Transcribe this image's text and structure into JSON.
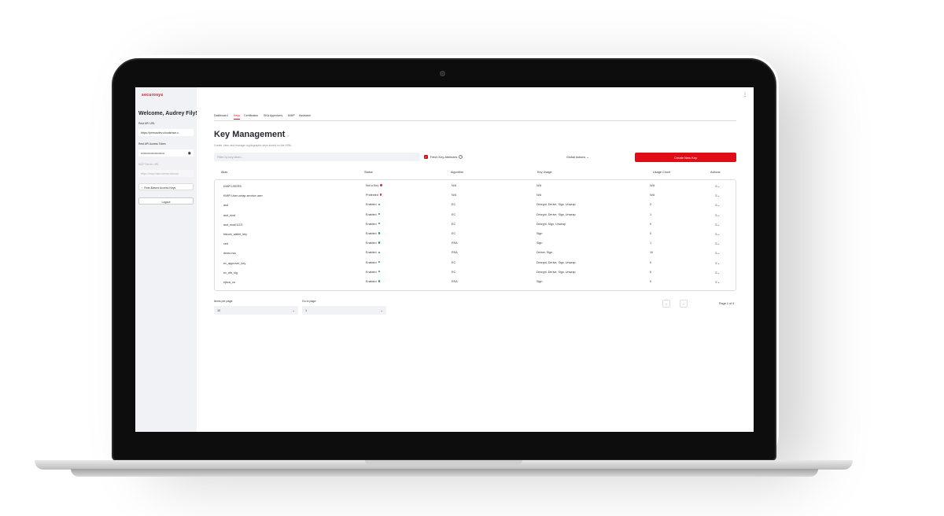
{
  "sidebar": {
    "brand": "securosys",
    "welcome": "Welcome, Audrey Fily!",
    "rest_url_label": "Rest API URL",
    "rest_url_value": "https://primusdev.cloudshsm.c",
    "token_label": "Rest API Access Token",
    "token_value": "••••••••••••••••••••••••",
    "mcp_label": "MCP Server URL",
    "mcp_placeholder": "https://mcp.hsm.server.securo",
    "rbac_label": "Role-Based Access Keys",
    "logout_label": "Logout"
  },
  "tabs": [
    "Dashboard",
    "Keys",
    "Certificates",
    "SKA Approvers",
    "KMIP",
    "Assistant"
  ],
  "active_tab": "Keys",
  "page": {
    "title": "Key Management",
    "description": "Create, view, and manage cryptographic keys stored on the HSM.",
    "filter_placeholder": "Filter by key label...",
    "fetch_attributes_label": "Fetch Key-Attributes",
    "global_actions_label": "Global Actions",
    "create_button": "Create New Key"
  },
  "table": {
    "headers": [
      "Alias",
      "Status",
      "Algorithm",
      "Key Usage",
      "Usage Count",
      "Actions"
    ],
    "rows": [
      {
        "alias": "KMIP-USERS",
        "status": "Not a Key",
        "status_color": "#e03030",
        "algorithm": "N/A",
        "usage": "N/A",
        "count": "N/A"
      },
      {
        "alias": "KMIP-User-ontap-service-user",
        "status": "Protected",
        "status_color": "#e03030",
        "algorithm": "N/A",
        "usage": "N/A",
        "count": "N/A"
      },
      {
        "alias": "asd",
        "status": "Enabled",
        "status_color": "#22aa44",
        "algorithm": "EC",
        "usage": "Decrypt, Derive, Sign, Unwrap",
        "count": "2"
      },
      {
        "alias": "asd_mod",
        "status": "Enabled",
        "status_color": "#22aa44",
        "algorithm": "EC",
        "usage": "Decrypt, Derive, Sign, Unwrap",
        "count": "1"
      },
      {
        "alias": "asd_mod/1/2/3",
        "status": "Enabled",
        "status_color": "#22aa44",
        "algorithm": "EC",
        "usage": "Decrypt, Sign, Unwrap",
        "count": "0"
      },
      {
        "alias": "bitcoin_wallet_key",
        "status": "Enabled",
        "status_color": "#22aa44",
        "algorithm": "EC",
        "usage": "Sign",
        "count": "0"
      },
      {
        "alias": "cert",
        "status": "Enabled",
        "status_color": "#22aa44",
        "algorithm": "RSA",
        "usage": "Sign",
        "count": "1"
      },
      {
        "alias": "demo-rsa",
        "status": "Enabled",
        "status_color": "#22aa44",
        "algorithm": "RSA",
        "usage": "Derive, Sign",
        "count": "10"
      },
      {
        "alias": "ec_approver_key",
        "status": "Enabled",
        "status_color": "#22aa44",
        "algorithm": "EC",
        "usage": "Decrypt, Derive, Sign, Unwrap",
        "count": "0"
      },
      {
        "alias": "ec_eth_sig",
        "status": "Enabled",
        "status_color": "#22aa44",
        "algorithm": "EC",
        "usage": "Decrypt, Derive, Sign, Unwrap",
        "count": "5"
      },
      {
        "alias": "ejbca_ca",
        "status": "Enabled",
        "status_color": "#22aa44",
        "algorithm": "RSA",
        "usage": "Sign",
        "count": "0"
      }
    ]
  },
  "pagination": {
    "items_label": "Items per page:",
    "items_value": "10",
    "goto_label": "Go to page:",
    "goto_value": "1",
    "prev": "‹",
    "next": "›",
    "page_info": "Page 1 of 4"
  },
  "colors": {
    "brand": "#e00c16",
    "sidebar_bg": "#f0f2f6"
  }
}
